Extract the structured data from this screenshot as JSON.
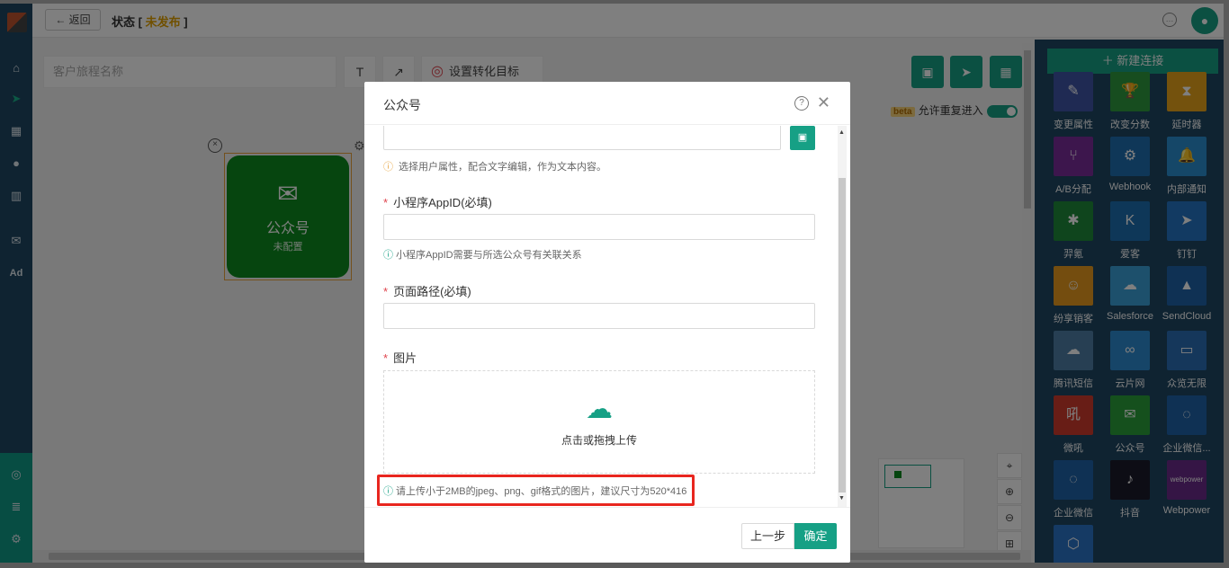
{
  "topbar": {
    "back_label": "← 返回",
    "status_prefix": "状态 [ ",
    "status_value": "未发布",
    "status_suffix": " ]"
  },
  "canvas": {
    "journey_name_placeholder": "客户旅程名称",
    "text_tool": "T",
    "arrow_tool": "↗",
    "goal_label": "设置转化目标",
    "beta_tag": "beta",
    "reentry_label": "允许重复进入",
    "node_title": "公众号",
    "node_subtitle": "未配置"
  },
  "right_panel": {
    "new_connection": "＋ 新建连接",
    "items": [
      {
        "label": "变更属性",
        "color": "#3f55a6",
        "icon": "edit-icon",
        "glyph": "✎"
      },
      {
        "label": "改变分数",
        "color": "#2e9a3e",
        "icon": "trophy-icon",
        "glyph": "🏆"
      },
      {
        "label": "延时器",
        "color": "#e9a41a",
        "icon": "hourglass-icon",
        "glyph": "⧗"
      },
      {
        "label": "A/B分配",
        "color": "#7a2d9a",
        "icon": "split-icon",
        "glyph": "⑂"
      },
      {
        "label": "Webhook",
        "color": "#1f6fb0",
        "icon": "webhook-icon",
        "glyph": "⚙"
      },
      {
        "label": "内部通知",
        "color": "#2b8fd0",
        "icon": "bell-icon",
        "glyph": "🔔"
      },
      {
        "label": "羿氪",
        "color": "#1e8a3a",
        "icon": "spider-icon",
        "glyph": "✱"
      },
      {
        "label": "爱客",
        "color": "#1c6fb0",
        "icon": "k-icon",
        "glyph": "K"
      },
      {
        "label": "钉钉",
        "color": "#2475c4",
        "icon": "dingtalk-icon",
        "glyph": "➤"
      },
      {
        "label": "纷享销客",
        "color": "#e99a1e",
        "icon": "robot-icon",
        "glyph": "☺"
      },
      {
        "label": "Salesforce",
        "color": "#3aa0d8",
        "icon": "cloud-icon",
        "glyph": "☁"
      },
      {
        "label": "SendCloud",
        "color": "#1e62a8",
        "icon": "mountain-icon",
        "glyph": "▲"
      },
      {
        "label": "腾讯短信",
        "color": "#4f7fa6",
        "icon": "tencent-cloud-icon",
        "glyph": "☁"
      },
      {
        "label": "云片网",
        "color": "#2d8ad0",
        "icon": "yunpian-icon",
        "glyph": "∞"
      },
      {
        "label": "众览无限",
        "color": "#2b6fb6",
        "icon": "zhonglan-icon",
        "glyph": "▭"
      },
      {
        "label": "微吼",
        "color": "#d03a2c",
        "icon": "vhall-icon",
        "glyph": "吼"
      },
      {
        "label": "公众号",
        "color": "#2ba13a",
        "icon": "wechat-icon",
        "glyph": "✉"
      },
      {
        "label": "企业微信...",
        "color": "#1e62a8",
        "icon": "work-wechat-icon",
        "glyph": "◌"
      },
      {
        "label": "企业微信",
        "color": "#1e62a8",
        "icon": "work-wechat-icon",
        "glyph": "◌"
      },
      {
        "label": "抖音",
        "color": "#1a1a2a",
        "icon": "tiktok-icon",
        "glyph": "♪"
      },
      {
        "label": "Webpower",
        "color": "#6a2a8a",
        "icon": "webpower-icon",
        "glyph": "webpower"
      },
      {
        "label": "",
        "color": "#2b74c8",
        "icon": "hexagon-icon",
        "glyph": "⬡"
      }
    ]
  },
  "modal": {
    "title": "公众号",
    "hint_user_attr": "选择用户属性，配合文字编辑，作为文本内容。",
    "appid_label": "小程序AppID(必填)",
    "appid_value": "",
    "appid_hint": "小程序AppID需要与所选公众号有关联关系",
    "path_label": "页面路径(必填)",
    "path_value": "",
    "image_label": "图片",
    "upload_text": "点击或拖拽上传",
    "upload_hint": "请上传小于2MB的jpeg、png、gif格式的图片，建议尺寸为520*416",
    "prev_label": "上一步",
    "ok_label": "确定"
  }
}
